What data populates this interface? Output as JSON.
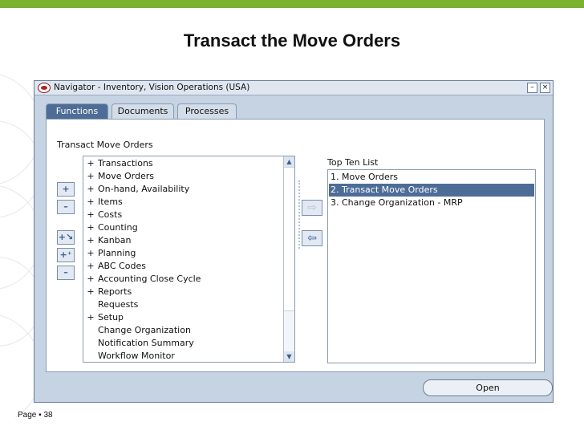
{
  "slide": {
    "title": "Transact the Move Orders",
    "page_label": "Page ▪ 38"
  },
  "accent_green": "#7ab32e",
  "window": {
    "title": "Navigator - Inventory, Vision Operations (USA)",
    "minimize_glyph": "–",
    "close_glyph": "×"
  },
  "tabs": [
    {
      "label": "Functions",
      "active": true
    },
    {
      "label": "Documents",
      "active": false
    },
    {
      "label": "Processes",
      "active": false
    }
  ],
  "panel_label": "Transact Move Orders",
  "side_buttons": [
    {
      "name": "expand-button",
      "glyph": "+"
    },
    {
      "name": "collapse-button",
      "glyph": "–"
    },
    {
      "name": "expand-branch-button",
      "glyph": "+↘"
    },
    {
      "name": "expand-all-button",
      "glyph": "+⁺"
    },
    {
      "name": "collapse-all-button",
      "glyph": "–"
    }
  ],
  "tree": [
    {
      "exp": "+",
      "label": "Transactions"
    },
    {
      "exp": "+",
      "label": "Move Orders"
    },
    {
      "exp": "+",
      "label": "On-hand, Availability"
    },
    {
      "exp": "+",
      "label": "Items"
    },
    {
      "exp": "+",
      "label": "Costs"
    },
    {
      "exp": "+",
      "label": "Counting"
    },
    {
      "exp": "+",
      "label": "Kanban"
    },
    {
      "exp": "+",
      "label": "Planning"
    },
    {
      "exp": "+",
      "label": "ABC Codes"
    },
    {
      "exp": "+",
      "label": "Accounting Close Cycle"
    },
    {
      "exp": "+",
      "label": "Reports"
    },
    {
      "exp": "",
      "label": "Requests"
    },
    {
      "exp": "+",
      "label": "Setup"
    },
    {
      "exp": "",
      "label": "Change Organization"
    },
    {
      "exp": "",
      "label": "Notification Summary"
    },
    {
      "exp": "",
      "label": "Workflow Monitor"
    }
  ],
  "scroll_up_glyph": "▲",
  "scroll_down_glyph": "▼",
  "add_button_glyph": "⇨",
  "remove_button_glyph": "⇦",
  "top_ten": {
    "label": "Top Ten List",
    "items": [
      {
        "label": "1. Move Orders",
        "selected": false
      },
      {
        "label": "2. Transact Move Orders",
        "selected": true
      },
      {
        "label": "3. Change Organization - MRP",
        "selected": false
      }
    ]
  },
  "open_button": "Open"
}
